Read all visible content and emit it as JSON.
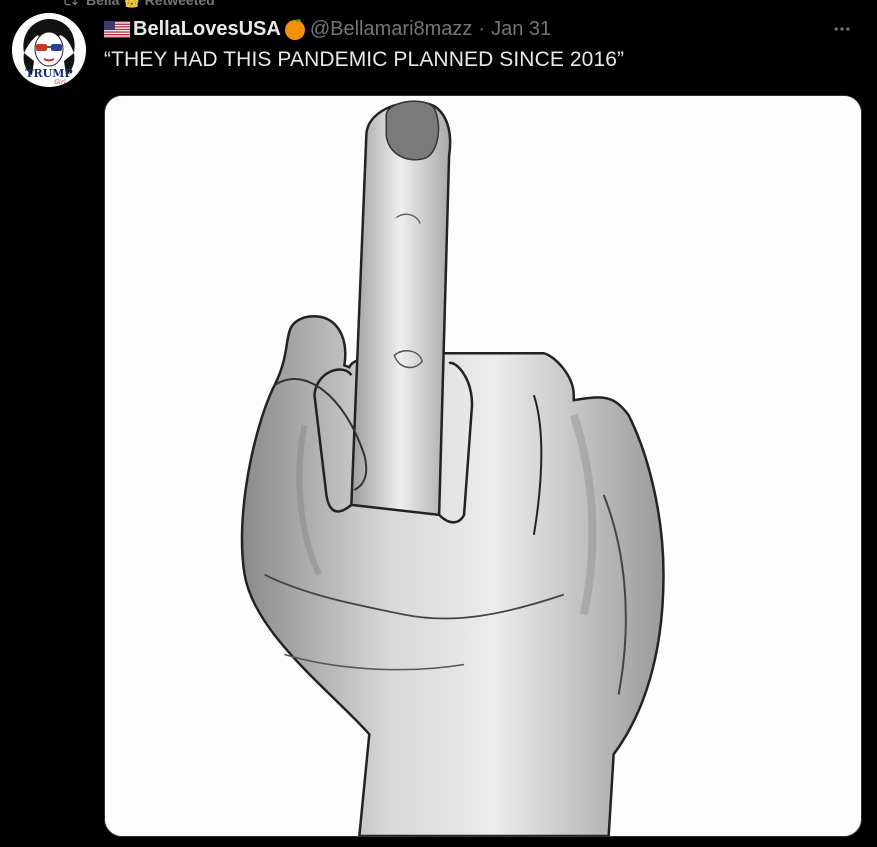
{
  "retweet": {
    "text": "Bella 👑 Retweeted",
    "icon": "retweet-icon"
  },
  "tweet": {
    "avatar": {
      "icon": "trump-girl-avatar",
      "text": "TRUMP",
      "subtext": "Girl"
    },
    "author": {
      "name": "BellaLovesUSA",
      "flag": "us-flag-icon",
      "emoji": "orange-icon",
      "handle": "@Bellamari8mazz",
      "separator": "·",
      "date": "Jan 31"
    },
    "text": "“THEY HAD THIS PANDEMIC PLANNED SINCE 2016”",
    "more_icon": "more-icon",
    "media": {
      "image": "middle-finger-drawing"
    }
  },
  "colors": {
    "background": "#000000",
    "primary_text": "#e7e9ea",
    "secondary_text": "#71767b"
  }
}
